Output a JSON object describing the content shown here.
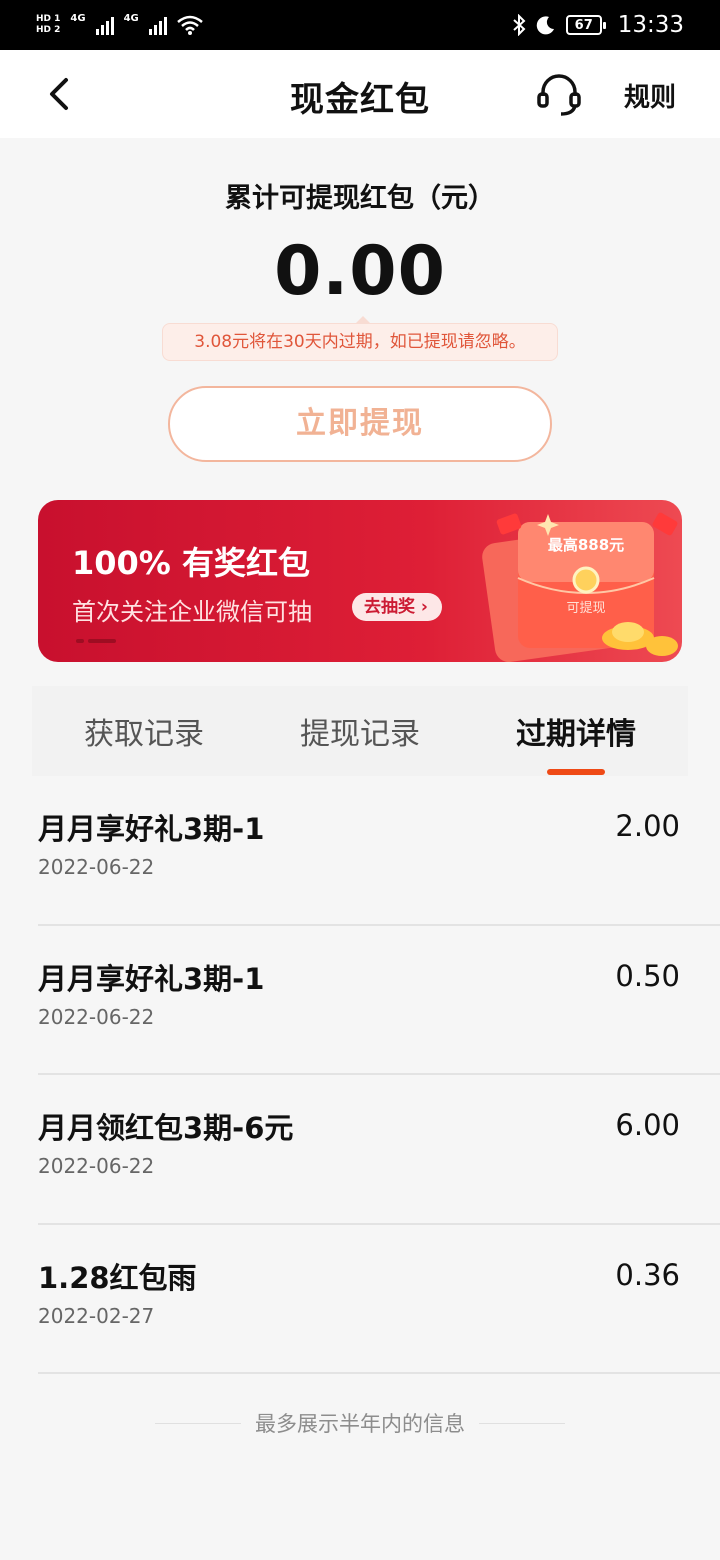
{
  "status_bar": {
    "hd1": "HD 1",
    "hd2": "HD 2",
    "net1": "4G",
    "net2": "4G",
    "battery": "67",
    "time": "13:33"
  },
  "header": {
    "title": "现金红包",
    "rules": "规则"
  },
  "summary": {
    "label": "累计可提现红包（元）",
    "amount": "0.00",
    "expire_tip": "3.08元将在30天内过期，如已提现请忽略。",
    "withdraw_label": "立即提现"
  },
  "banner": {
    "title": "100% 有奖红包",
    "subtitle": "首次关注企业微信可抽",
    "cta": "去抽奖 ›",
    "envelope_top": "最高888元",
    "envelope_bottom": "可提现"
  },
  "tabs": [
    {
      "label": "获取记录",
      "active": false
    },
    {
      "label": "提现记录",
      "active": false
    },
    {
      "label": "过期详情",
      "active": true
    }
  ],
  "records": [
    {
      "name": "月月享好礼3期-1",
      "date": "2022-06-22",
      "amount": "2.00"
    },
    {
      "name": "月月享好礼3期-1",
      "date": "2022-06-22",
      "amount": "0.50"
    },
    {
      "name": "月月领红包3期-6元",
      "date": "2022-06-22",
      "amount": "6.00"
    },
    {
      "name": "1.28红包雨",
      "date": "2022-02-27",
      "amount": "0.36"
    }
  ],
  "footer_note": "最多展示半年内的信息",
  "colors": {
    "accent": "#ef4a16",
    "banner_red": "#d81b35",
    "tip_text": "#e0563a",
    "button_border": "#f3b69d"
  }
}
